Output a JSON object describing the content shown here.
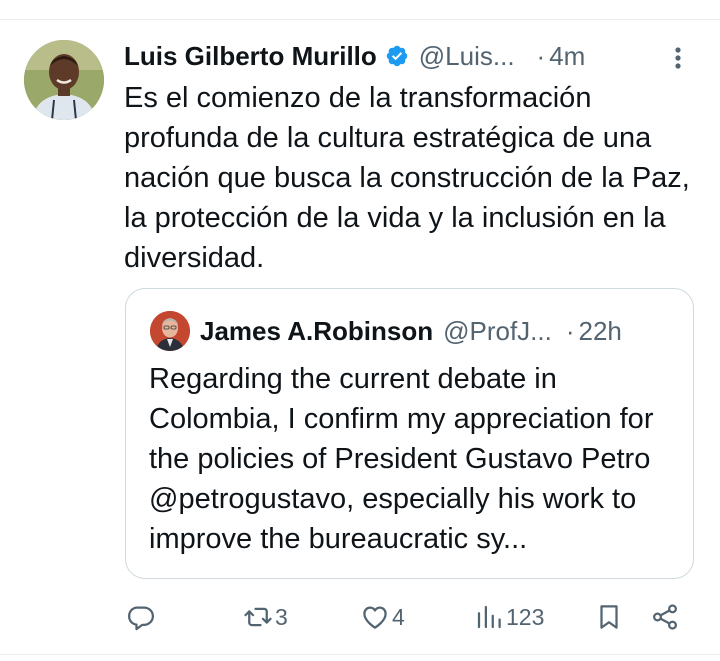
{
  "tweet": {
    "author_name": "Luis Gilberto Murillo",
    "handle": "@Luis...",
    "separator": "·",
    "time": "4m",
    "text": "Es el comienzo de la transformación profunda de la cultura estratégica de una nación que busca la construcción de la Paz, la protección de la vida y la inclusión en la diversidad."
  },
  "quoted": {
    "author_name": "James A.Robinson",
    "handle": "@ProfJ...",
    "separator": "·",
    "time": "22h",
    "text": "Regarding the current debate in Colombia, I confirm my appreciation for the policies of President Gustavo Petro @petrogustavo, especially his work to improve the bureaucratic sy..."
  },
  "actions": {
    "reply_count": "",
    "retweet_count": "3",
    "like_count": "4",
    "views_count": "123"
  },
  "colors": {
    "verified": "#1d9bf0",
    "muted": "#536471",
    "text": "#0f1419",
    "border": "#cfd9de"
  }
}
